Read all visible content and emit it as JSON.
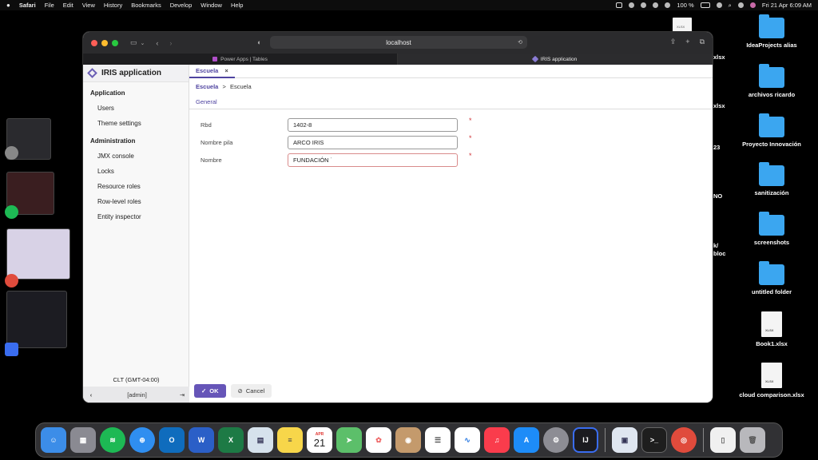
{
  "menubar": {
    "apple": "",
    "app": "Safari",
    "menus": [
      "File",
      "Edit",
      "View",
      "History",
      "Bookmarks",
      "Develop",
      "Window",
      "Help"
    ],
    "battery": "100 %",
    "datetime": "Fri 21 Apr  6:09 AM"
  },
  "desktop": {
    "icons": [
      {
        "label": "IdeaProjects alias",
        "kind": "folder"
      },
      {
        "label": "archivos ricardo",
        "kind": "folder"
      },
      {
        "label": "Proyecto Innovación",
        "kind": "folder"
      },
      {
        "label": "sanitización",
        "kind": "folder"
      },
      {
        "label": "screenshots",
        "kind": "folder"
      },
      {
        "label": "untitled folder",
        "kind": "folder"
      },
      {
        "label": "Book1.xlsx",
        "kind": "file"
      },
      {
        "label": "cloud comparison.xlsx",
        "kind": "file"
      }
    ],
    "peek_texts": [
      "xlsx",
      "xlsx",
      "23",
      "NO",
      "k/",
      "bloc"
    ]
  },
  "browser": {
    "url": "localhost",
    "tabs": [
      {
        "label": "Power Apps | Tables",
        "active": false
      },
      {
        "label": "IRIS application",
        "active": true
      }
    ]
  },
  "sidebar": {
    "title": "IRIS application",
    "groups": [
      {
        "label": "Application",
        "items": [
          "Users",
          "Theme settings"
        ]
      },
      {
        "label": "Administration",
        "items": [
          "JMX console",
          "Locks",
          "Resource roles",
          "Row-level roles",
          "Entity inspector"
        ]
      }
    ],
    "timezone": "CLT (GMT-04:00)",
    "user": "[admin]"
  },
  "main": {
    "tab_label": "Escuela",
    "breadcrumb": {
      "parent": "Escuela",
      "separator": ">",
      "current": "Escuela"
    },
    "subtab": "General",
    "fields": [
      {
        "label": "Rbd",
        "value": "1402-8",
        "required": true
      },
      {
        "label": "Nombre pila",
        "value": "ARCO IRIS",
        "required": true
      },
      {
        "label": "Nombre",
        "value": "FUNDACIÓN ˙",
        "required": true
      }
    ],
    "ok_label": "OK",
    "cancel_label": "Cancel"
  },
  "dock": {
    "apps": [
      "finder",
      "launchpad",
      "spotify",
      "safari",
      "outlook",
      "word",
      "excel",
      "preview",
      "notes",
      "calendar",
      "maps",
      "photos",
      "contacts",
      "reminders",
      "freeform",
      "music",
      "app-store",
      "system-settings",
      "intellij",
      "preview-docs",
      "terminal",
      "chrome",
      "document",
      "trash"
    ],
    "calendar_month": "APR",
    "calendar_day": "21"
  }
}
